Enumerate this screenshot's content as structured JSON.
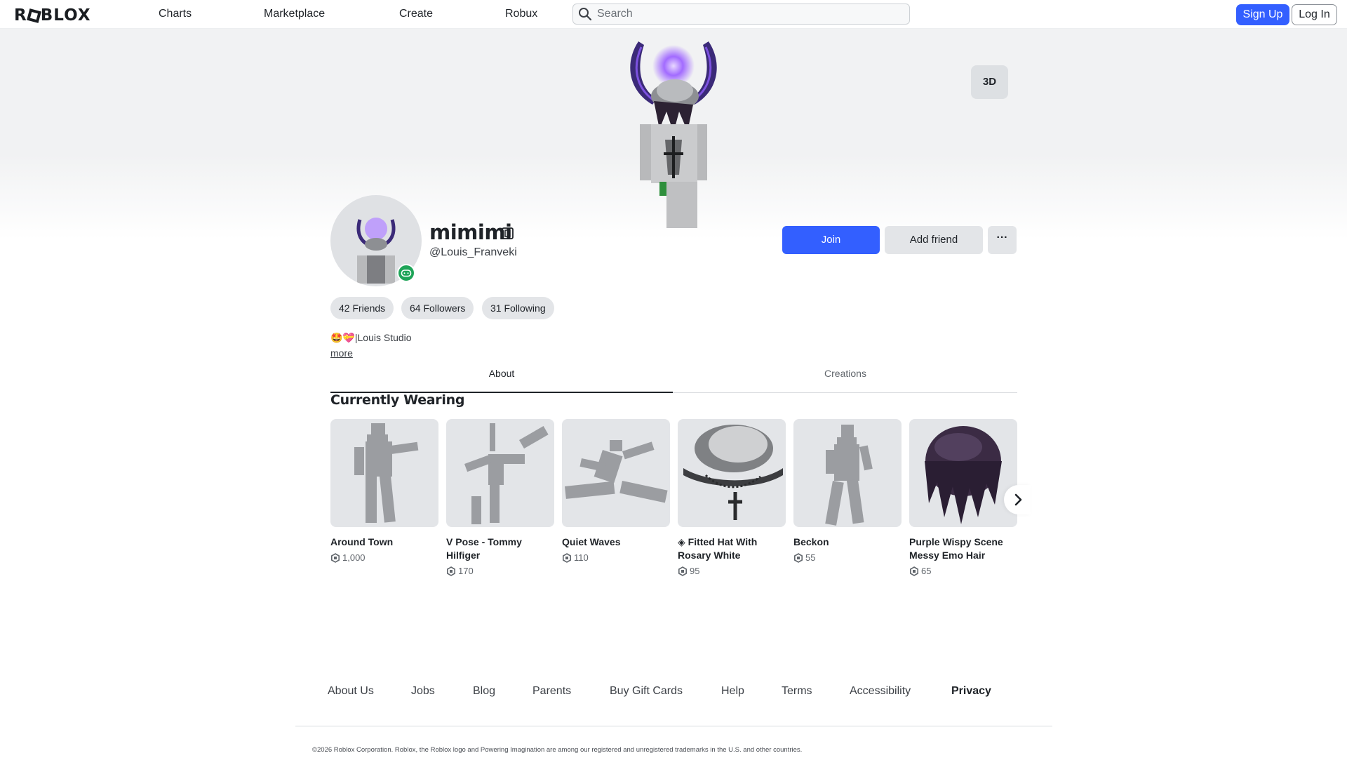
{
  "nav": {
    "logo": "ROBLOX",
    "links": [
      "Charts",
      "Marketplace",
      "Create",
      "Robux"
    ],
    "search_placeholder": "Search",
    "signup": "Sign Up",
    "login": "Log In"
  },
  "hero": {
    "view_3d": "3D"
  },
  "profile": {
    "display_name": "mimimi",
    "username": "@Louis_Franveki",
    "join": "Join",
    "add_friend": "Add friend",
    "more_menu": "···",
    "stats": [
      "42 Friends",
      "64 Followers",
      "31 Following"
    ],
    "bio": "🤩💝|Louis Studio",
    "more": "more"
  },
  "tabs": [
    "About",
    "Creations"
  ],
  "active_tab": "About",
  "wearing": {
    "title": "Currently Wearing",
    "items": [
      {
        "name": "Around Town",
        "price": "1,000",
        "icon": "emote-figure-icon"
      },
      {
        "name": "V Pose - Tommy Hilfiger",
        "price": "170",
        "icon": "emote-figure-icon"
      },
      {
        "name": "Quiet Waves",
        "price": "110",
        "icon": "emote-figure-icon"
      },
      {
        "name": "◈ Fitted Hat With Rosary White",
        "price": "95",
        "icon": "hat-icon"
      },
      {
        "name": "Beckon",
        "price": "55",
        "icon": "emote-figure-icon"
      },
      {
        "name": "Purple Wispy Scene Messy Emo Hair",
        "price": "65",
        "icon": "hair-icon"
      }
    ]
  },
  "footer": {
    "links": [
      "About Us",
      "Jobs",
      "Blog",
      "Parents",
      "Buy Gift Cards",
      "Help",
      "Terms",
      "Accessibility",
      "Privacy"
    ],
    "copyright": "©2026 Roblox Corporation. Roblox, the Roblox logo and Powering Imagination are among our registered and unregistered trademarks in the U.S. and other countries."
  },
  "colors": {
    "accent": "#335fff",
    "online_badge": "#1ea458",
    "pill_bg": "#e3e5e8"
  }
}
